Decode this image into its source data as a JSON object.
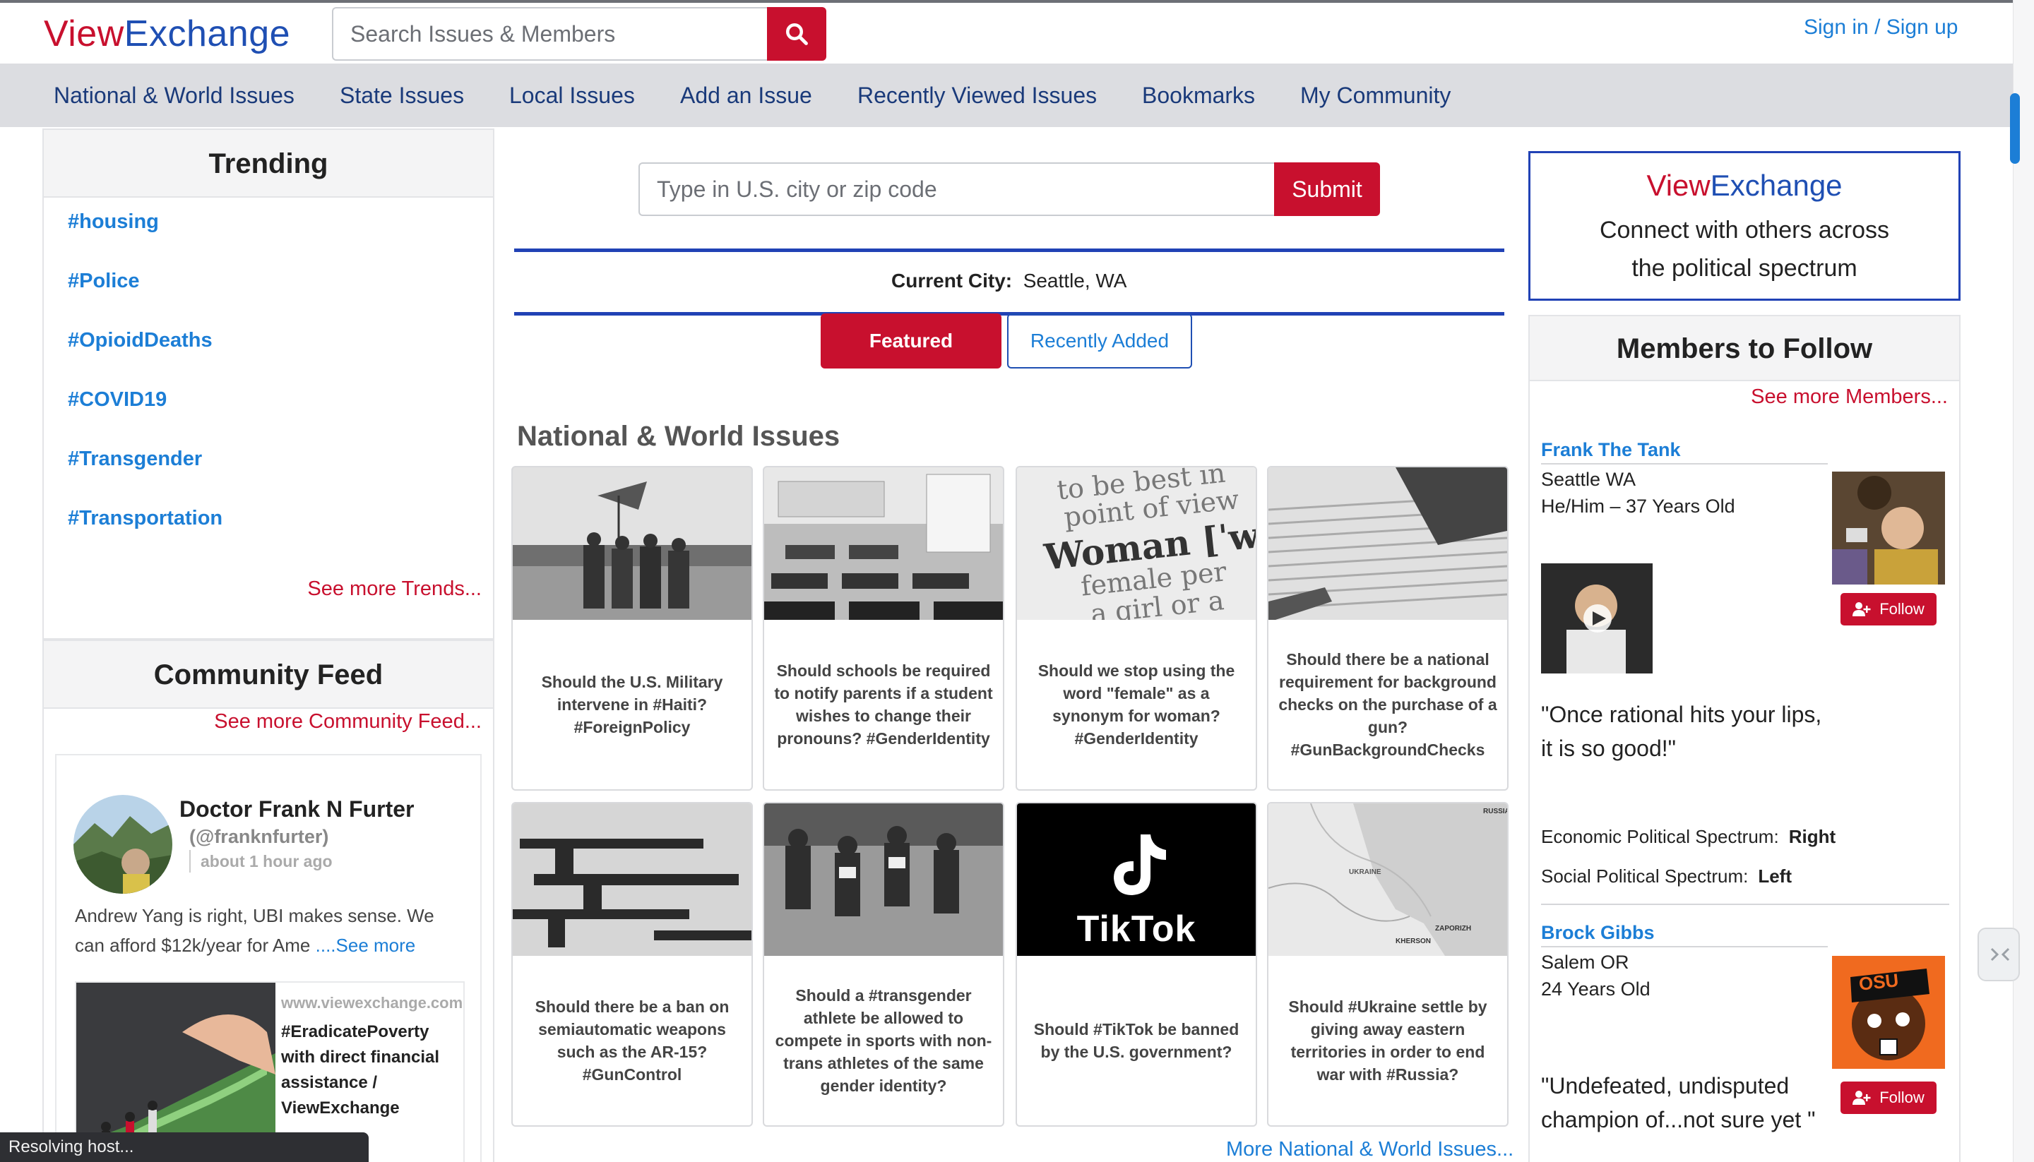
{
  "header": {
    "logo_part1": "View",
    "logo_part2": "Exchange",
    "search_placeholder": "Search Issues & Members",
    "signin": "Sign in / Sign up"
  },
  "nav": {
    "items": [
      "National & World Issues",
      "State Issues",
      "Local Issues",
      "Add an Issue",
      "Recently Viewed Issues",
      "Bookmarks",
      "My Community"
    ]
  },
  "trending": {
    "title": "Trending",
    "tags": [
      "#housing",
      "#Police",
      "#OpioidDeaths",
      "#COVID19",
      "#Transgender",
      "#Transportation"
    ],
    "more": "See more Trends..."
  },
  "feed": {
    "title": "Community Feed",
    "more": "See more Community Feed...",
    "post": {
      "author": "Doctor Frank N Furter",
      "handle": "(@franknfurter)",
      "time": "about 1 hour ago",
      "text": "Andrew Yang is right, UBI makes sense. We can afford $12k/year for Ame",
      "see_more": "....See more",
      "preview_domain": "www.viewexchange.com",
      "preview_title": "#EradicatePoverty with direct financial assistance / ViewExchange"
    }
  },
  "city": {
    "placeholder": "Type in U.S. city or zip code",
    "submit": "Submit",
    "current_label": "Current City:",
    "current_value": "Seattle, WA"
  },
  "tabs": {
    "featured": "Featured",
    "recent": "Recently Added"
  },
  "issues": {
    "section_title": "National & World Issues",
    "cards": [
      "Should the U.S. Military intervene in #Haiti? #ForeignPolicy",
      "Should schools be required to notify parents if a student wishes to change their pronouns? #GenderIdentity",
      "Should we stop using the word \"female\" as a synonym for woman? #GenderIdentity",
      "Should there be a national requirement for background checks on the purchase of a gun? #GunBackgroundChecks",
      "Should there be a ban on semiautomatic weapons such as the AR-15? #GunControl",
      "Should a #transgender athlete be allowed to compete in sports with non-trans athletes of the same gender identity?",
      "Should #TikTok be banned by the U.S. government?",
      "Should #Ukraine settle by giving away eastern territories in order to end war with #Russia?"
    ],
    "image_text": {
      "dictionary": [
        "to be best in",
        "point of view",
        "Woman [ˈw",
        "female per",
        "a girl or a"
      ],
      "tiktok": "TikTok",
      "map_ukraine": "UKRAINE",
      "map_russia": "RUSSIA",
      "map_kherson": "KHERSON",
      "map_zaporizh": "ZAPORIZH"
    },
    "more": "More National & World Issues..."
  },
  "promo": {
    "logo_part1": "View",
    "logo_part2": "Exchange",
    "text_line1": "Connect with others across",
    "text_line2": "the political spectrum"
  },
  "members": {
    "title": "Members to Follow",
    "more": "See more Members...",
    "follow_label": "Follow",
    "list": [
      {
        "name": "Frank The Tank",
        "location": "Seattle WA",
        "details": "He/Him – 37 Years Old",
        "quote_line1": "\"Once rational hits your lips,",
        "quote_line2": "it is so good!\"",
        "econ_label": "Economic Political Spectrum:",
        "econ_value": "Right",
        "social_label": "Social Political Spectrum:",
        "social_value": "Left"
      },
      {
        "name": "Brock Gibbs",
        "location": "Salem OR",
        "details": "24 Years Old",
        "badge_text": "OSU",
        "quote_line1": "\"Undefeated, undisputed",
        "quote_line2": "champion of...not sure yet \""
      }
    ]
  },
  "status": "Resolving host...",
  "colors": {
    "brand_red": "#c8102e",
    "brand_blue": "#1f4fb3",
    "link_blue": "#1c7ed6",
    "nav_bg": "#dcdde1"
  }
}
